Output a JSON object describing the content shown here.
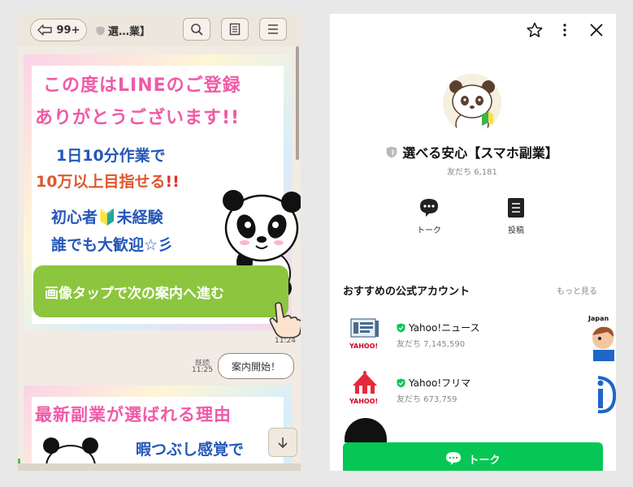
{
  "chat": {
    "back_count": "99+",
    "title": "選…業】",
    "banner": {
      "line1": "この度はLINEのご登録",
      "line2": "ありがとうございます!!",
      "line3": "1日10分作業で",
      "line4a": "10万以上目指せる",
      "line4b": "!!",
      "line5": "初心者🔰未経験",
      "line6": "誰でも大歓迎☆彡",
      "cta": "画像タップで次の案内へ進む"
    },
    "time1": "11:24",
    "read_label": "既読",
    "time2": "11:25",
    "bubble": "案内開始！",
    "banner2": {
      "line1": "最新副業が選ばれる理由",
      "line2": "暇つぶし感覚で"
    }
  },
  "profile": {
    "name": "選べる安心【スマホ副業】",
    "friends": "友だち 6,181",
    "actions": [
      {
        "label": "トーク",
        "icon": "chat-bubble-icon"
      },
      {
        "label": "投稿",
        "icon": "post-icon"
      }
    ],
    "recommend_title": "おすすめの公式アカウント",
    "recommend_more": "もっと見る",
    "recommendations": [
      {
        "name": "Yahoo!ニュース",
        "friends": "友だち 7,145,590",
        "logo_text": "YAHOO!"
      },
      {
        "name": "Yahoo!フリマ",
        "friends": "友だち 673,759",
        "logo_text": "YAHOO!"
      }
    ],
    "side_label": "Japan",
    "talk_button": "トーク"
  },
  "colors": {
    "line_green": "#06c755",
    "cta_green": "#8cc63f",
    "pink_text": "#f05aa7",
    "blue_text": "#2457b8"
  }
}
